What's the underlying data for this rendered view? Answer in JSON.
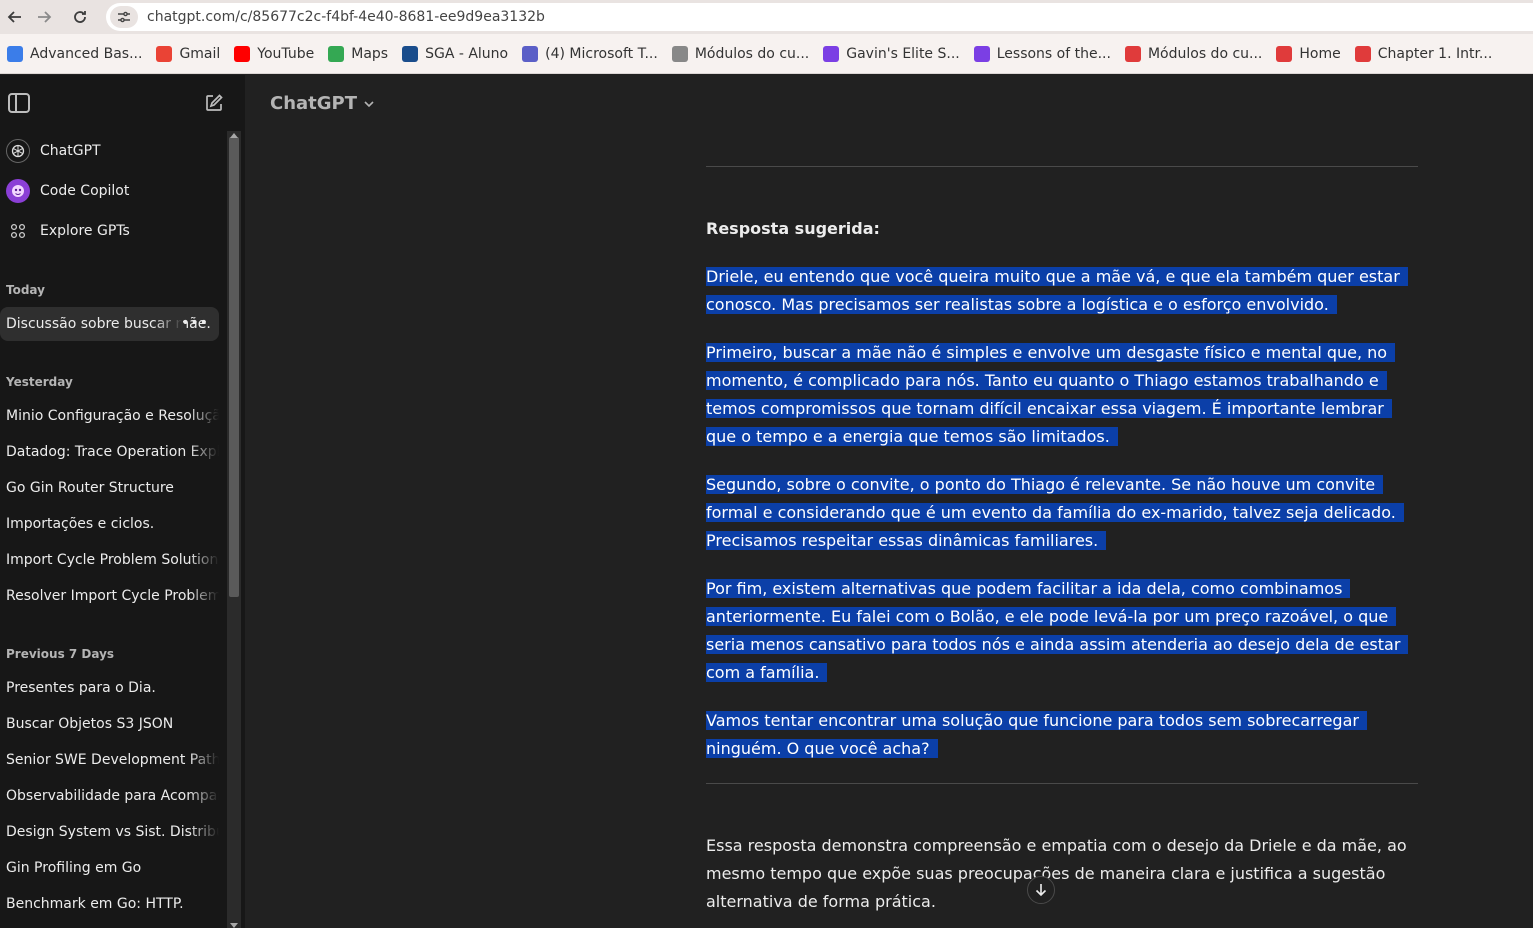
{
  "browser": {
    "url": "chatgpt.com/c/85677c2c-f4bf-4e40-8681-ee9d9ea3132b",
    "bookmarks": [
      {
        "label": "Advanced Bas...",
        "color": "#3b7de9"
      },
      {
        "label": "Gmail",
        "color": "#ea4335"
      },
      {
        "label": "YouTube",
        "color": "#ff0000"
      },
      {
        "label": "Maps",
        "color": "#34a853"
      },
      {
        "label": "SGA - Aluno",
        "color": "#1a4d8c"
      },
      {
        "label": "(4) Microsoft T...",
        "color": "#5b5fc7"
      },
      {
        "label": "Módulos do cu...",
        "color": "#888888"
      },
      {
        "label": "Gavin's Elite S...",
        "color": "#7b3fe4"
      },
      {
        "label": "Lessons of the...",
        "color": "#7b3fe4"
      },
      {
        "label": "Módulos do cu...",
        "color": "#e03b3b"
      },
      {
        "label": "Home",
        "color": "#e03b3b"
      },
      {
        "label": "Chapter 1. Intr...",
        "color": "#e03b3b"
      }
    ]
  },
  "sidebar": {
    "gpts": [
      {
        "label": "ChatGPT"
      },
      {
        "label": "Code Copilot"
      },
      {
        "label": "Explore GPTs"
      }
    ],
    "sections": {
      "today": "Today",
      "yesterday": "Yesterday",
      "previous7": "Previous 7 Days"
    },
    "today_items": [
      "Discussão sobre buscar mãe."
    ],
    "yesterday_items": [
      "Minio Configuração e Resolução",
      "Datadog: Trace Operation Explained",
      "Go Gin Router Structure",
      "Importações e ciclos.",
      "Import Cycle Problem Solution",
      "Resolver Import Cycle Problem"
    ],
    "previous7_items": [
      "Presentes para o Dia.",
      "Buscar Objetos S3 JSON",
      "Senior SWE Development Path",
      "Observabilidade para Acompanhamento",
      "Design System vs Sist. Distribuídos",
      "Gin Profiling em Go",
      "Benchmark em Go: HTTP."
    ]
  },
  "main": {
    "model": "ChatGPT",
    "heading": "Resposta sugerida:",
    "paragraphs": [
      "Driele, eu entendo que você queira muito que a mãe vá, e que ela também quer estar conosco. Mas precisamos ser realistas sobre a logística e o esforço envolvido.",
      "Primeiro, buscar a mãe não é simples e envolve um desgaste físico e mental que, no momento, é complicado para nós. Tanto eu quanto o Thiago estamos trabalhando e temos compromissos que tornam difícil encaixar essa viagem. É importante lembrar que o tempo e a energia que temos são limitados.",
      "Segundo, sobre o convite, o ponto do Thiago é relevante. Se não houve um convite formal e considerando que é um evento da família do ex-marido, talvez seja delicado. Precisamos respeitar essas dinâmicas familiares.",
      "Por fim, existem alternativas que podem facilitar a ida dela, como combinamos anteriormente. Eu falei com o Bolão, e ele pode levá-la por um preço razoável, o que seria menos cansativo para todos nós e ainda assim atenderia ao desejo dela de estar com a família.",
      "Vamos tentar encontrar uma solução que funcione para todos sem sobrecarregar ninguém. O que você acha?"
    ],
    "closing": "Essa resposta demonstra compreensão e empatia com o desejo da Driele e da mãe, ao mesmo tempo que expõe suas preocupações de maneira clara e justifica a sugestão alternativa de forma prática."
  },
  "colors": {
    "selection": "#0b3fa8",
    "sidebar_bg": "#171717",
    "main_bg": "#212121"
  }
}
